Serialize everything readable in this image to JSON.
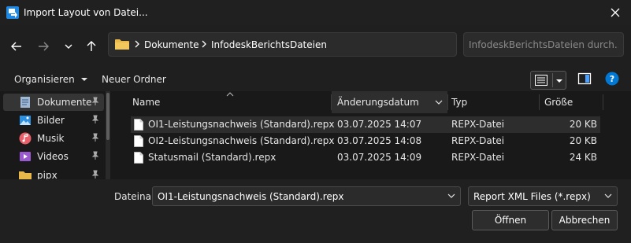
{
  "window": {
    "title": "Import Layout von Datei..."
  },
  "address": {
    "crumbs": [
      "Dokumente",
      "InfodeskBerichtsDateien"
    ]
  },
  "search": {
    "placeholder": "InfodeskBerichtsDateien durch..."
  },
  "toolbar": {
    "organize_label": "Organisieren",
    "new_folder_label": "Neuer Ordner"
  },
  "sidebar": {
    "items": [
      {
        "label": "Dokumente",
        "icon": "documents-icon",
        "selected": true
      },
      {
        "label": "Bilder",
        "icon": "pictures-icon"
      },
      {
        "label": "Musik",
        "icon": "music-icon"
      },
      {
        "label": "Videos",
        "icon": "videos-icon"
      },
      {
        "label": "pipx",
        "icon": "folder-icon"
      }
    ]
  },
  "file_list": {
    "columns": [
      "Name",
      "Änderungsdatum",
      "Typ",
      "Größe"
    ],
    "rows": [
      {
        "name": "OI1-Leistungsnachweis (Standard).repx",
        "date": "03.07.2025 14:07",
        "type": "REPX-Datei",
        "size": "20 KB",
        "selected": true
      },
      {
        "name": "OI2-Leistungsnachweis (Standard).repx",
        "date": "03.07.2025 14:08",
        "type": "REPX-Datei",
        "size": "20 KB"
      },
      {
        "name": "Statusmail (Standard).repx",
        "date": "03.07.2025 14:09",
        "type": "REPX-Datei",
        "size": "24 KB"
      }
    ]
  },
  "footer": {
    "filename_label": "Dateiname:",
    "filename_value": "OI1-Leistungsnachweis (Standard).repx",
    "filetype_value": "Report XML Files (*.repx)",
    "open_label": "Öffnen",
    "cancel_label": "Abbrechen"
  },
  "colors": {
    "background": "#191919",
    "accent": "#0078d4",
    "folder": "#e8b84a"
  }
}
